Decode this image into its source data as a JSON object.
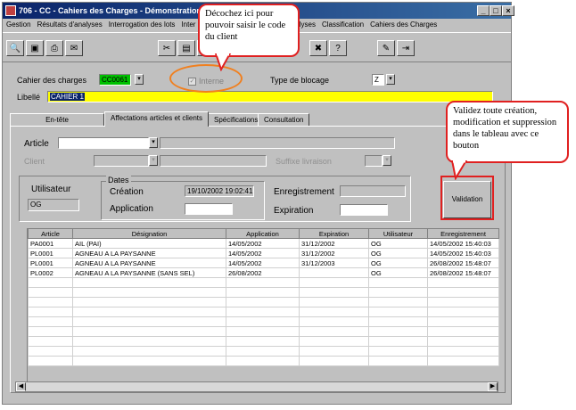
{
  "window": {
    "title": "706 - CC - Cahiers des Charges - Démonstration 2.0",
    "controls": [
      "_",
      "□",
      "×"
    ]
  },
  "menu": [
    "Gestion",
    "Résultats d'analyses",
    "Interrogation des lots",
    "Inter",
    "d'analyses",
    "Classification",
    "Cahiers des Charges"
  ],
  "toolbar_icons": [
    "search-icon",
    "printer-preview-icon",
    "printer-icon",
    "mail-icon",
    "scissors-icon",
    "copy-icon",
    "save-icon",
    "delete-icon",
    "arrow-icon",
    "help-icon",
    "tools-icon",
    "exit-icon"
  ],
  "form": {
    "cahier_label": "Cahier des charges",
    "cahier_value": "CC0061",
    "interne_label": "Interne",
    "type_blocage_label": "Type de blocage",
    "type_blocage_value": "Z",
    "libelle_label": "Libellé",
    "libelle_value": "CAHIER 1"
  },
  "tabs": [
    "En-tête",
    "Affectations articles et clients",
    "Spécifications",
    "Consultation"
  ],
  "panel": {
    "article_label": "Article",
    "client_label": "Client",
    "suffixe_label": "Suffixe livraison",
    "utilisateur_label": "Utilisateur",
    "utilisateur_value": "OG",
    "dates_label": "Dates",
    "creation_label": "Création",
    "creation_value": "19/10/2002 19:02:41",
    "enregistrement_label": "Enregistrement",
    "application_label": "Application",
    "expiration_label": "Expiration",
    "validation_button": "Validation"
  },
  "table": {
    "headers": [
      "Article",
      "Désignation",
      "Application",
      "Expiration",
      "Utilisateur",
      "Enregistrement"
    ],
    "rows": [
      [
        "PA0001",
        "AIL (PAI)",
        "14/05/2002",
        "31/12/2002",
        "OG",
        "14/05/2002 15:40:03"
      ],
      [
        "PL0001",
        "AGNEAU A LA PAYSANNE",
        "14/05/2002",
        "31/12/2002",
        "OG",
        "14/05/2002 15:40:03"
      ],
      [
        "PL0001",
        "AGNEAU A LA PAYSANNE",
        "14/05/2002",
        "31/12/2003",
        "OG",
        "26/08/2002 15:48:07"
      ],
      [
        "PL0002",
        "AGNEAU A LA PAYSANNE (SANS SEL)",
        "26/08/2002",
        "",
        "OG",
        "26/08/2002 15:48:07"
      ]
    ]
  },
  "callouts": {
    "top": "Décochez ici pour pouvoir saisir le code du client",
    "right": "Validez toute création, modification et suppression dans le tableau avec ce bouton"
  },
  "colors": {
    "accent_green": "#00c000",
    "libelle_yellow": "#ffff00",
    "callout_border": "#e02020",
    "oval": "#f08020"
  }
}
